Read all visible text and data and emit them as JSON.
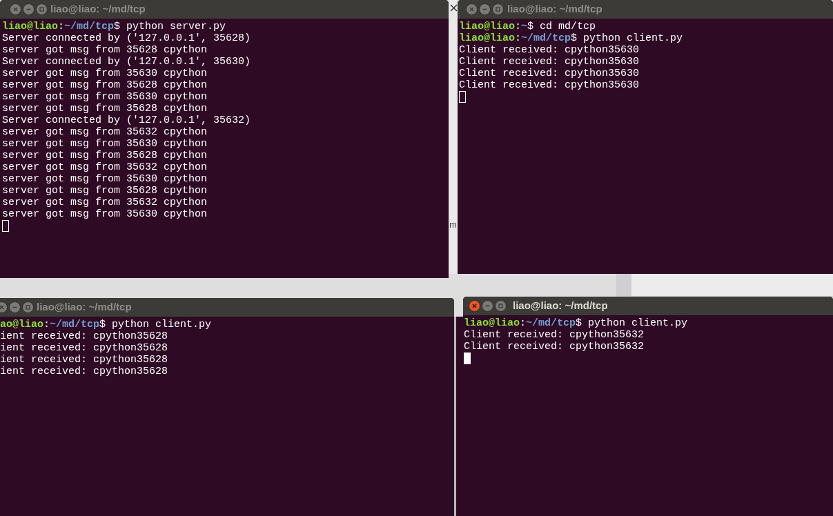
{
  "desktop": {
    "fragments": [
      {
        "text": "m"
      }
    ]
  },
  "windows": [
    {
      "title": "liao@liao: ~/md/tcp",
      "active": false,
      "cursor": {
        "filled": false
      },
      "lines": [
        {
          "kind": "prompt",
          "user": "liao@liao",
          "colon": ":",
          "path": "~/md/tcp",
          "command": "$ python server.py"
        },
        {
          "kind": "output",
          "text": "Server connected by ('127.0.0.1', 35628)"
        },
        {
          "kind": "output",
          "text": "server got msg from 35628 cpython"
        },
        {
          "kind": "output",
          "text": "Server connected by ('127.0.0.1', 35630)"
        },
        {
          "kind": "output",
          "text": "server got msg from 35630 cpython"
        },
        {
          "kind": "output",
          "text": "server got msg from 35628 cpython"
        },
        {
          "kind": "output",
          "text": "server got msg from 35630 cpython"
        },
        {
          "kind": "output",
          "text": "server got msg from 35628 cpython"
        },
        {
          "kind": "output",
          "text": "Server connected by ('127.0.0.1', 35632)"
        },
        {
          "kind": "output",
          "text": "server got msg from 35632 cpython"
        },
        {
          "kind": "output",
          "text": "server got msg from 35630 cpython"
        },
        {
          "kind": "output",
          "text": "server got msg from 35628 cpython"
        },
        {
          "kind": "output",
          "text": "server got msg from 35632 cpython"
        },
        {
          "kind": "output",
          "text": "server got msg from 35630 cpython"
        },
        {
          "kind": "output",
          "text": "server got msg from 35628 cpython"
        },
        {
          "kind": "output",
          "text": "server got msg from 35632 cpython"
        },
        {
          "kind": "output",
          "text": "server got msg from 35630 cpython"
        }
      ]
    },
    {
      "title": "liao@liao: ~/md/tcp",
      "active": false,
      "cursor": {
        "filled": false
      },
      "lines": [
        {
          "kind": "prompt",
          "user": "liao@liao",
          "colon": ":",
          "path": "~",
          "command": "$ cd md/tcp"
        },
        {
          "kind": "prompt",
          "user": "liao@liao",
          "colon": ":",
          "path": "~/md/tcp",
          "command": "$ python client.py"
        },
        {
          "kind": "output",
          "text": "Client received: cpython35630"
        },
        {
          "kind": "output",
          "text": "Client received: cpython35630"
        },
        {
          "kind": "output",
          "text": "Client received: cpython35630"
        },
        {
          "kind": "output",
          "text": "Client received: cpython35630"
        }
      ]
    },
    {
      "title": "liao@liao: ~/md/tcp",
      "active": false,
      "lines": [
        {
          "kind": "prompt",
          "user": "ao@liao",
          "colon": ":",
          "path": "~/md/tcp",
          "command": "$ python client.py"
        },
        {
          "kind": "output",
          "text": "ient received: cpython35628"
        },
        {
          "kind": "output",
          "text": "ient received: cpython35628"
        },
        {
          "kind": "output",
          "text": "ient received: cpython35628"
        },
        {
          "kind": "output",
          "text": "ient received: cpython35628"
        }
      ]
    },
    {
      "title": "liao@liao: ~/md/tcp",
      "active": true,
      "cursor": {
        "filled": true
      },
      "lines": [
        {
          "kind": "prompt",
          "user": "liao@liao",
          "colon": ":",
          "path": "~/md/tcp",
          "command": "$ python client.py"
        },
        {
          "kind": "output",
          "text": "Client received: cpython35632"
        },
        {
          "kind": "output",
          "text": "Client received: cpython35632"
        }
      ]
    }
  ]
}
